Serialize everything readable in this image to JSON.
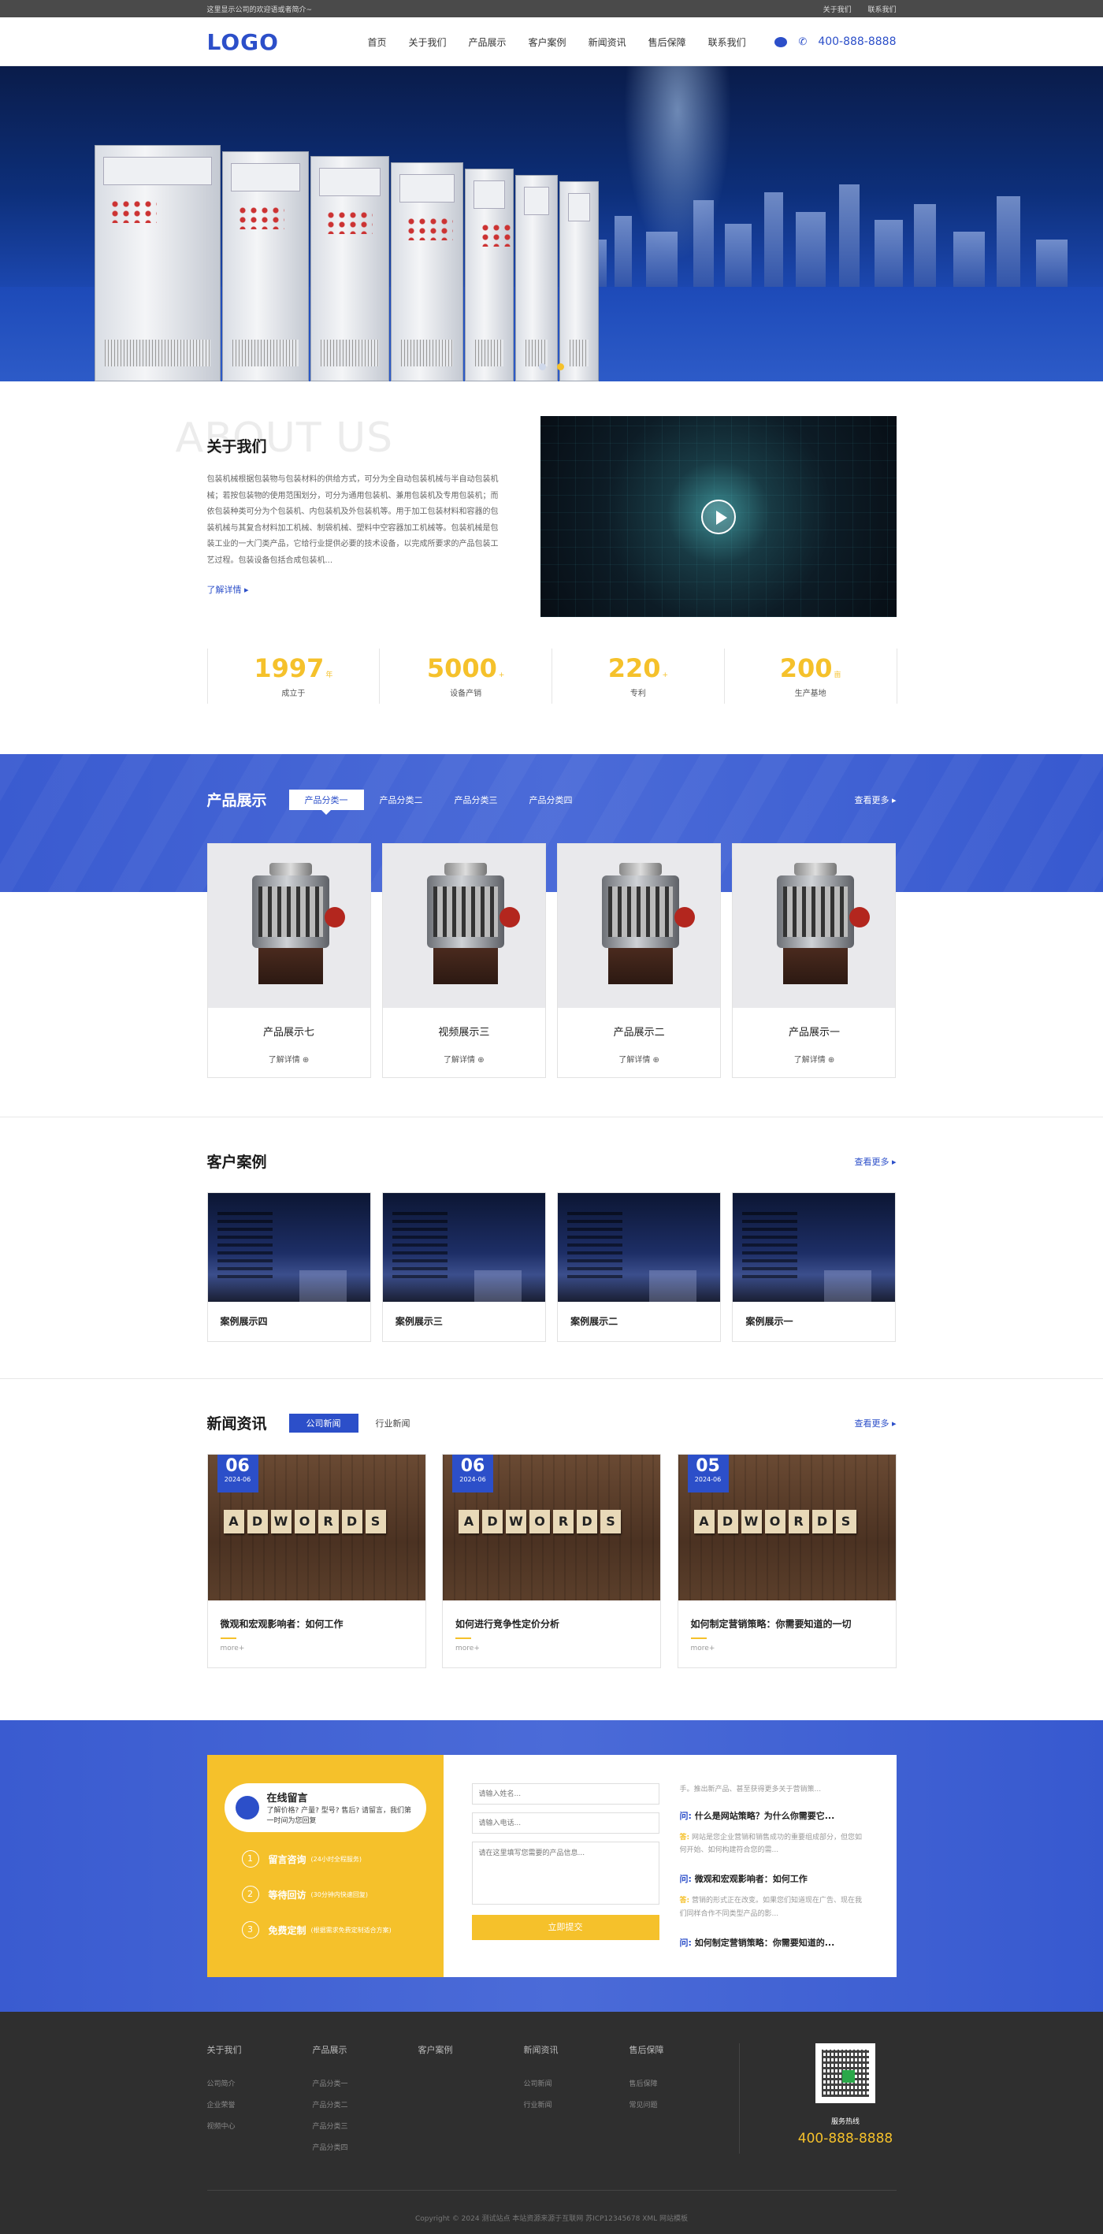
{
  "topbar": {
    "welcome": "这里显示公司的欢迎语或者简介~",
    "links": [
      "关于我们",
      "联系我们"
    ]
  },
  "header": {
    "logo": "LOGO",
    "nav": [
      "首页",
      "关于我们",
      "产品展示",
      "客户案例",
      "新闻资讯",
      "售后保障",
      "联系我们"
    ],
    "phone": "400-888-8888"
  },
  "about": {
    "ghost": "ABOUT US",
    "title": "关于我们",
    "text": "包装机械根据包装物与包装材料的供给方式，可分为全自动包装机械与半自动包装机械；若按包装物的使用范围划分，可分为通用包装机、兼用包装机及专用包装机；而依包装种类可分为个包装机、内包装机及外包装机等。用于加工包装材料和容器的包装机械与其复合材料加工机械、制袋机械、塑料中空容器加工机械等。包装机械是包装工业的一大门类产品，它给行业提供必要的技术设备，以完成所要求的产品包装工艺过程。包装设备包括合成包装机...",
    "more": "了解详情",
    "stats": [
      {
        "num": "1997",
        "unit": "年",
        "label": "成立于"
      },
      {
        "num": "5000",
        "unit": "+",
        "label": "设备产销"
      },
      {
        "num": "220",
        "unit": "+",
        "label": "专利"
      },
      {
        "num": "200",
        "unit": "亩",
        "label": "生产基地"
      }
    ]
  },
  "products": {
    "title": "产品展示",
    "tabs": [
      "产品分类一",
      "产品分类二",
      "产品分类三",
      "产品分类四"
    ],
    "more": "查看更多",
    "items": [
      {
        "name": "产品展示七",
        "btn": "了解详情"
      },
      {
        "name": "视频展示三",
        "btn": "了解详情"
      },
      {
        "name": "产品展示二",
        "btn": "了解详情"
      },
      {
        "name": "产品展示一",
        "btn": "了解详情"
      }
    ]
  },
  "cases": {
    "title": "客户案例",
    "more": "查看更多",
    "items": [
      "案例展示四",
      "案例展示三",
      "案例展示二",
      "案例展示一"
    ]
  },
  "news": {
    "title": "新闻资讯",
    "tabs": [
      "公司新闻",
      "行业新闻"
    ],
    "more": "查看更多",
    "tile_word": [
      "A",
      "D",
      "W",
      "O",
      "R",
      "D",
      "S"
    ],
    "items": [
      {
        "day": "06",
        "ym": "2024-06",
        "title": "微观和宏观影响者：如何工作",
        "more": "more+"
      },
      {
        "day": "06",
        "ym": "2024-06",
        "title": "如何进行竞争性定价分析",
        "more": "more+"
      },
      {
        "day": "05",
        "ym": "2024-06",
        "title": "如何制定营销策略：你需要知道的一切",
        "more": "more+"
      }
    ]
  },
  "contact": {
    "bubble_title": "在线留言",
    "bubble_sub": "了解价格? 产量? 型号? 售后? 请留言，我们第一时间为您回复",
    "steps": [
      {
        "n": "1",
        "k": "留言咨询",
        "v": "(24小时全程服务)"
      },
      {
        "n": "2",
        "k": "等待回访",
        "v": "(30分钟内快速回复)"
      },
      {
        "n": "3",
        "k": "免费定制",
        "v": "(根据需求免费定制适合方案)"
      }
    ],
    "form": {
      "name_ph": "请输入姓名...",
      "phone_ph": "请输入电话...",
      "msg_ph": "请在这里填写您需要的产品信息...",
      "submit": "立即提交"
    },
    "qa_top": "手。推出新产品、甚至获得更多关于营销策...",
    "qa": [
      {
        "q": "什么是网站策略？为什么你需要它...",
        "a": "网站是您企业营销和销售成功的重要组成部分，但您如何开始、如何构建符合您的需..."
      },
      {
        "q": "微观和宏观影响者：如何工作",
        "a": "营销的形式正在改变。如果您们知道现在广告、现在我们同样合作不同类型产品的影..."
      },
      {
        "q": "如何制定营销策略：你需要知道的...",
        "a": ""
      }
    ],
    "q_mark": "问:",
    "a_mark": "答:"
  },
  "footer": {
    "cols": [
      {
        "title": "关于我们",
        "items": [
          "公司简介",
          "企业荣誉",
          "视频中心"
        ]
      },
      {
        "title": "产品展示",
        "items": [
          "产品分类一",
          "产品分类二",
          "产品分类三",
          "产品分类四"
        ]
      },
      {
        "title": "客户案例",
        "items": []
      },
      {
        "title": "新闻资讯",
        "items": [
          "公司新闻",
          "行业新闻"
        ]
      },
      {
        "title": "售后保障",
        "items": [
          "售后保障",
          "常见问题"
        ]
      }
    ],
    "hotline_label": "服务热线",
    "hotline": "400-888-8888",
    "copyright": "Copyright © 2024 测试站点 本站资源来源于互联网 苏ICP12345678 XML 网站模板"
  },
  "colors": {
    "primary": "#2c4fc9",
    "accent": "#f5c12b",
    "footer": "#2f2f2f"
  }
}
